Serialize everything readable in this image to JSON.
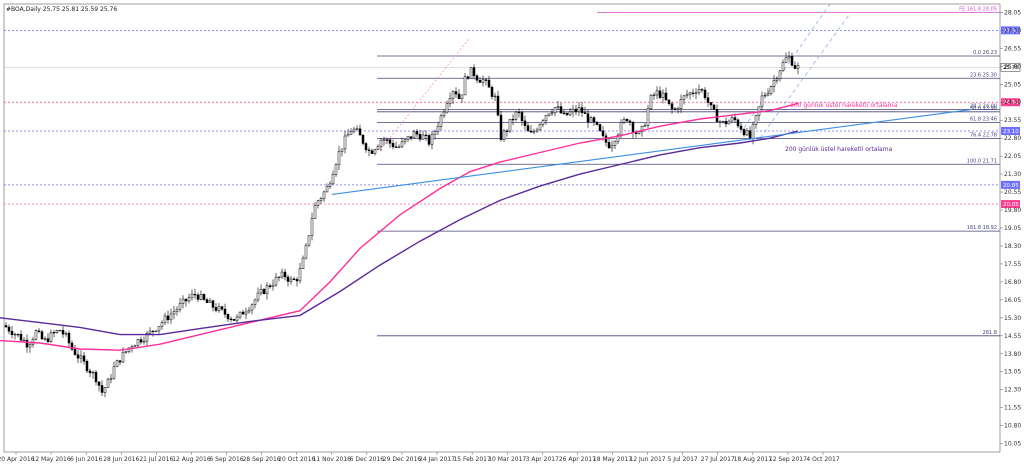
{
  "chart_data": {
    "type": "candlestick",
    "title": "#BOA,Daily  25.75 25.81 25.59 25.76",
    "ylim": [
      9.7,
      28.4
    ],
    "y_ticks": [
      "28.05",
      "27.30",
      "26.55",
      "25.80",
      "25.05",
      "24.30",
      "23.55",
      "22.80",
      "22.05",
      "21.30",
      "20.55",
      "19.80",
      "19.05",
      "18.30",
      "17.55",
      "16.80",
      "16.05",
      "15.30",
      "14.55",
      "13.80",
      "13.05",
      "12.30",
      "11.55",
      "10.80",
      "10.05"
    ],
    "x_ticks": [
      "20 Apr 2016",
      "12 May 2016",
      "6 Jun 2016",
      "28 Jun 2016",
      "21 Jul 2016",
      "12 Aug 2016",
      "6 Sep 2016",
      "28 Sep 2016",
      "20 Oct 2016",
      "11 Nov 2016",
      "6 Dec 2016",
      "29 Dec 2016",
      "24 Jan 2017",
      "15 Feb 2017",
      "10 Mar 2017",
      "3 Apr 2017",
      "26 Apr 2017",
      "18 May 2017",
      "12 Jun 2017",
      "5 Jul 2017",
      "27 Jul 2017",
      "18 Aug 2017",
      "12 Sep 2017",
      "4 Oct 2017"
    ],
    "price_path": [
      [
        0,
        15.1
      ],
      [
        10,
        14.8
      ],
      [
        20,
        14.5
      ],
      [
        28,
        14.2
      ],
      [
        36,
        14.7
      ],
      [
        44,
        14.3
      ],
      [
        52,
        14.6
      ],
      [
        60,
        14.8
      ],
      [
        66,
        14.5
      ],
      [
        72,
        14.0
      ],
      [
        80,
        13.6
      ],
      [
        88,
        13.2
      ],
      [
        96,
        12.8
      ],
      [
        102,
        12.2
      ],
      [
        108,
        12.6
      ],
      [
        114,
        13.2
      ],
      [
        120,
        13.6
      ],
      [
        126,
        13.9
      ],
      [
        132,
        14.2
      ],
      [
        140,
        14.4
      ],
      [
        148,
        14.6
      ],
      [
        156,
        14.9
      ],
      [
        164,
        15.2
      ],
      [
        172,
        15.5
      ],
      [
        180,
        15.8
      ],
      [
        188,
        16.1
      ],
      [
        196,
        16.3
      ],
      [
        204,
        16.0
      ],
      [
        212,
        15.8
      ],
      [
        220,
        15.6
      ],
      [
        228,
        15.4
      ],
      [
        236,
        15.2
      ],
      [
        244,
        15.6
      ],
      [
        252,
        15.9
      ],
      [
        260,
        16.3
      ],
      [
        268,
        16.6
      ],
      [
        276,
        16.9
      ],
      [
        284,
        17.1
      ],
      [
        292,
        16.8
      ],
      [
        298,
        17.0
      ],
      [
        304,
        17.8
      ],
      [
        308,
        18.6
      ],
      [
        312,
        19.5
      ],
      [
        316,
        20.1
      ],
      [
        322,
        20.4
      ],
      [
        328,
        20.8
      ],
      [
        334,
        21.6
      ],
      [
        340,
        22.3
      ],
      [
        346,
        22.8
      ],
      [
        352,
        23.2
      ],
      [
        358,
        23.0
      ],
      [
        364,
        22.6
      ],
      [
        370,
        22.2
      ],
      [
        376,
        22.5
      ],
      [
        382,
        22.8
      ],
      [
        390,
        22.6
      ],
      [
        398,
        22.4
      ],
      [
        406,
        22.7
      ],
      [
        414,
        23.0
      ],
      [
        422,
        22.9
      ],
      [
        430,
        22.6
      ],
      [
        436,
        23.2
      ],
      [
        442,
        23.8
      ],
      [
        448,
        24.5
      ],
      [
        454,
        24.9
      ],
      [
        460,
        24.4
      ],
      [
        466,
        25.4
      ],
      [
        472,
        25.6
      ],
      [
        478,
        25.3
      ],
      [
        484,
        25.2
      ],
      [
        490,
        24.8
      ],
      [
        496,
        24.4
      ],
      [
        500,
        22.8
      ],
      [
        506,
        23.1
      ],
      [
        512,
        23.6
      ],
      [
        518,
        23.9
      ],
      [
        524,
        23.3
      ],
      [
        530,
        22.9
      ],
      [
        536,
        23.2
      ],
      [
        542,
        23.6
      ],
      [
        548,
        23.9
      ],
      [
        556,
        24.1
      ],
      [
        564,
        23.7
      ],
      [
        572,
        23.9
      ],
      [
        580,
        24.0
      ],
      [
        588,
        23.6
      ],
      [
        596,
        23.3
      ],
      [
        604,
        22.7
      ],
      [
        610,
        22.5
      ],
      [
        616,
        22.9
      ],
      [
        622,
        23.4
      ],
      [
        628,
        23.7
      ],
      [
        634,
        23.1
      ],
      [
        640,
        22.9
      ],
      [
        646,
        23.6
      ],
      [
        650,
        24.4
      ],
      [
        656,
        24.7
      ],
      [
        662,
        24.6
      ],
      [
        668,
        24.2
      ],
      [
        674,
        23.9
      ],
      [
        680,
        24.3
      ],
      [
        686,
        24.6
      ],
      [
        692,
        24.7
      ],
      [
        698,
        24.9
      ],
      [
        704,
        24.7
      ],
      [
        710,
        24.1
      ],
      [
        716,
        23.7
      ],
      [
        722,
        23.4
      ],
      [
        728,
        23.5
      ],
      [
        734,
        23.6
      ],
      [
        740,
        23.3
      ],
      [
        746,
        23.0
      ],
      [
        750,
        22.8
      ],
      [
        756,
        23.6
      ],
      [
        762,
        24.5
      ],
      [
        768,
        24.8
      ],
      [
        774,
        25.2
      ],
      [
        780,
        25.7
      ],
      [
        786,
        26.1
      ],
      [
        790,
        26.2
      ],
      [
        794,
        25.8
      ],
      [
        798,
        25.76
      ]
    ],
    "fib_levels": [
      {
        "label": "FE 161.8 28.05",
        "value": 28.05,
        "color": "#d050c8",
        "x0": 597
      },
      {
        "label": "0.0 26.23",
        "value": 26.23,
        "color": "#44447a",
        "x0": 377
      },
      {
        "label": "23.6 25.30",
        "value": 25.3,
        "color": "#44447a",
        "x0": 377
      },
      {
        "label": "38.2 24.00",
        "value": 24.0,
        "color": "#44447a",
        "x0": 377
      },
      {
        "label": "50.0 23.90",
        "value": 23.9,
        "color": "#44447a",
        "x0": 377
      },
      {
        "label": "61.8 23.46",
        "value": 23.46,
        "color": "#44447a",
        "x0": 377
      },
      {
        "label": "76.4 22.78",
        "value": 22.78,
        "color": "#44447a",
        "x0": 377
      },
      {
        "label": "100.0 21.71",
        "value": 21.71,
        "color": "#44447a",
        "x0": 377
      },
      {
        "label": "161.8 18.92",
        "value": 18.92,
        "color": "#44447a",
        "x0": 377
      },
      {
        "label": "261.8",
        "value": 14.55,
        "color": "#44447a",
        "x0": 377
      }
    ],
    "dotted_levels": [
      {
        "value": 27.3,
        "color": "#6f6fff",
        "label": "27.30"
      },
      {
        "value": 24.3,
        "color": "#ff3f8f",
        "label": "24.30"
      },
      {
        "value": 23.1,
        "color": "#6f6fff",
        "label": "23.10"
      },
      {
        "value": 20.85,
        "color": "#6f6fff",
        "label": "20.85"
      },
      {
        "value": 20.05,
        "color": "#ff3f8f",
        "label": "20.05"
      }
    ],
    "current_price": {
      "value": 25.76,
      "label": "25.76"
    },
    "ma100": {
      "label": "100 günlük üstel hareketli ortalama",
      "color": "#ff2f9a",
      "points": [
        [
          0,
          14.35
        ],
        [
          40,
          14.25
        ],
        [
          80,
          14.0
        ],
        [
          120,
          13.95
        ],
        [
          160,
          14.2
        ],
        [
          200,
          14.6
        ],
        [
          250,
          15.1
        ],
        [
          300,
          15.6
        ],
        [
          330,
          16.8
        ],
        [
          360,
          18.2
        ],
        [
          400,
          19.6
        ],
        [
          440,
          20.7
        ],
        [
          470,
          21.4
        ],
        [
          500,
          21.8
        ],
        [
          540,
          22.2
        ],
        [
          580,
          22.6
        ],
        [
          620,
          22.9
        ],
        [
          660,
          23.3
        ],
        [
          700,
          23.6
        ],
        [
          740,
          23.8
        ],
        [
          770,
          23.95
        ],
        [
          798,
          24.25
        ]
      ]
    },
    "ma200": {
      "label": "200 günlük üstel hareketli ortalama",
      "color": "#5a2a9a",
      "points": [
        [
          0,
          15.3
        ],
        [
          40,
          15.1
        ],
        [
          80,
          14.9
        ],
        [
          120,
          14.6
        ],
        [
          160,
          14.6
        ],
        [
          200,
          14.85
        ],
        [
          250,
          15.15
        ],
        [
          300,
          15.4
        ],
        [
          340,
          16.4
        ],
        [
          380,
          17.5
        ],
        [
          420,
          18.5
        ],
        [
          460,
          19.4
        ],
        [
          500,
          20.2
        ],
        [
          540,
          20.8
        ],
        [
          580,
          21.3
        ],
        [
          620,
          21.7
        ],
        [
          660,
          22.1
        ],
        [
          700,
          22.4
        ],
        [
          740,
          22.6
        ],
        [
          770,
          22.8
        ],
        [
          798,
          23.1
        ]
      ]
    },
    "trendline": {
      "color": "#3a8fe0",
      "from": [
        332,
        20.45
      ],
      "to": [
        972,
        24.0
      ]
    }
  }
}
